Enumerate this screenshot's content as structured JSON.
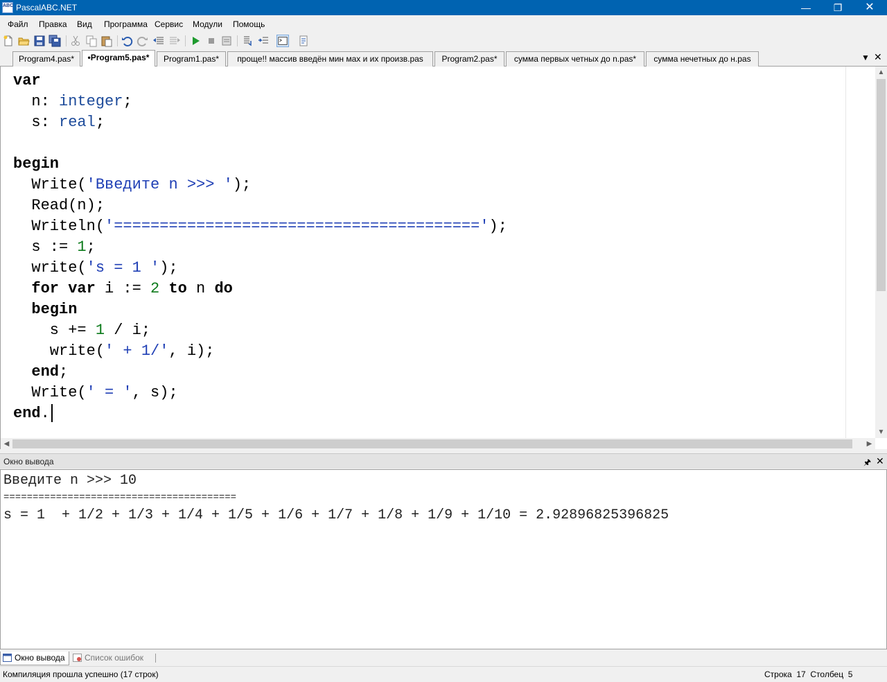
{
  "window": {
    "title": "PascalABC.NET",
    "icon_label": "ABC"
  },
  "menu": [
    "Файл",
    "Правка",
    "Вид",
    "Программа",
    "Сервис",
    "Модули",
    "Помощь"
  ],
  "tabs": [
    {
      "label": "Program4.pas*"
    },
    {
      "label": "•Program5.pas*"
    },
    {
      "label": "Program1.pas*"
    },
    {
      "label": "проще!! массив введён мин мах и их произв.pas"
    },
    {
      "label": "Program2.pas*"
    },
    {
      "label": "сумма первых четных до n.pas*"
    },
    {
      "label": "сумма нечетных до н.pas"
    }
  ],
  "active_tab": "•Program5.pas*",
  "code_lines": [
    [
      [
        "kw",
        "var"
      ]
    ],
    [
      [
        "pl",
        "  n: "
      ],
      [
        "ty",
        "integer"
      ],
      [
        "pl",
        ";"
      ]
    ],
    [
      [
        "pl",
        "  s: "
      ],
      [
        "ty",
        "real"
      ],
      [
        "pl",
        ";"
      ]
    ],
    [],
    [
      [
        "kw",
        "begin"
      ]
    ],
    [
      [
        "pl",
        "  Write("
      ],
      [
        "str",
        "'Введите n >>> '"
      ],
      [
        "pl",
        ");"
      ]
    ],
    [
      [
        "pl",
        "  Read(n);"
      ]
    ],
    [
      [
        "pl",
        "  Writeln("
      ],
      [
        "str",
        "'========================================'"
      ],
      [
        "pl",
        ");"
      ]
    ],
    [
      [
        "pl",
        "  s := "
      ],
      [
        "num",
        "1"
      ],
      [
        "pl",
        ";"
      ]
    ],
    [
      [
        "pl",
        "  write("
      ],
      [
        "str",
        "'s = 1 '"
      ],
      [
        "pl",
        ");"
      ]
    ],
    [
      [
        "pl",
        "  "
      ],
      [
        "kw",
        "for var"
      ],
      [
        "pl",
        " i := "
      ],
      [
        "num",
        "2"
      ],
      [
        "pl",
        " "
      ],
      [
        "kw",
        "to"
      ],
      [
        "pl",
        " n "
      ],
      [
        "kw",
        "do"
      ]
    ],
    [
      [
        "pl",
        "  "
      ],
      [
        "kw",
        "begin"
      ]
    ],
    [
      [
        "pl",
        "    s += "
      ],
      [
        "num",
        "1"
      ],
      [
        "pl",
        " / i;"
      ]
    ],
    [
      [
        "pl",
        "    write("
      ],
      [
        "str",
        "' + 1/'"
      ],
      [
        "pl",
        ", i);"
      ]
    ],
    [
      [
        "pl",
        "  "
      ],
      [
        "kw",
        "end"
      ],
      [
        "pl",
        ";"
      ]
    ],
    [
      [
        "pl",
        "  Write("
      ],
      [
        "str",
        "' = '"
      ],
      [
        "pl",
        ", s);"
      ]
    ],
    [
      [
        "kw",
        "end"
      ],
      [
        "pl",
        "."
      ]
    ]
  ],
  "output_panel": {
    "title": "Окно вывода",
    "lines": [
      "Введите n >>> 10",
      "========================================",
      "s = 1  + 1/2 + 1/3 + 1/4 + 1/5 + 1/6 + 1/7 + 1/8 + 1/9 + 1/10 = 2.92896825396825"
    ]
  },
  "bottom_tabs": [
    {
      "label": "Окно вывода",
      "icon": "output-window-icon"
    },
    {
      "label": "Список ошибок",
      "icon": "error-list-icon"
    }
  ],
  "status": {
    "message": "Компиляция прошла успешно (17 строк)",
    "position": "Строка  17  Столбец  5"
  },
  "colors": {
    "titlebar": "#0063b1",
    "keyword": "#000000",
    "type": "#1c4a9a",
    "string": "#1f3fb5",
    "number": "#0b7a1a"
  }
}
